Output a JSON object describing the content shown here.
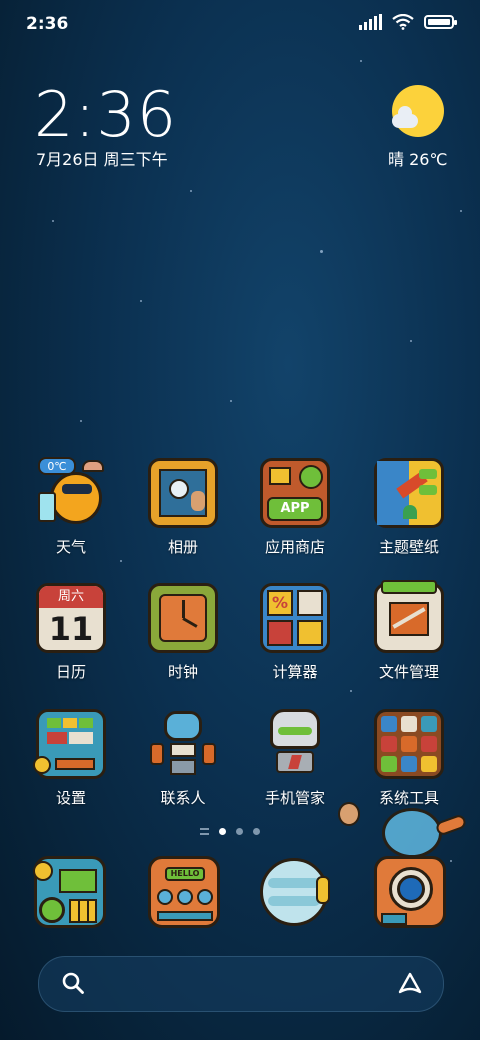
{
  "status_bar": {
    "time": "2:36"
  },
  "clock_widget": {
    "time": "2:36",
    "date": "7月26日 周三下午",
    "weather": "晴 26℃"
  },
  "apps": [
    {
      "name": "weather",
      "label": "天气",
      "badge": "0℃"
    },
    {
      "name": "gallery",
      "label": "相册"
    },
    {
      "name": "app-store",
      "label": "应用商店",
      "badge": "APP"
    },
    {
      "name": "themes",
      "label": "主题壁纸"
    },
    {
      "name": "calendar",
      "label": "日历",
      "day_label": "周六",
      "day_number": "11"
    },
    {
      "name": "clock",
      "label": "时钟"
    },
    {
      "name": "calculator",
      "label": "计算器"
    },
    {
      "name": "file-manager",
      "label": "文件管理"
    },
    {
      "name": "settings",
      "label": "设置"
    },
    {
      "name": "contacts",
      "label": "联系人"
    },
    {
      "name": "security",
      "label": "手机管家"
    },
    {
      "name": "tools",
      "label": "系统工具"
    }
  ],
  "dock": [
    {
      "name": "phone"
    },
    {
      "name": "messages",
      "badge": "HELLO"
    },
    {
      "name": "browser"
    },
    {
      "name": "camera"
    }
  ],
  "page_indicator": {
    "pages": 3,
    "current": 1
  },
  "colors": {
    "accent_green": "#6fbf3a",
    "sun_yellow": "#fcd23b",
    "bg_deep": "#0b3050"
  }
}
